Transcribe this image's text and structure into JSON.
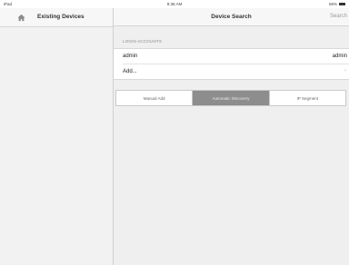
{
  "status_bar": {
    "device": "iPad",
    "time": "9:38 AM",
    "battery": "56%"
  },
  "sidebar": {
    "title": "Existing Devices",
    "home_icon": "home-icon"
  },
  "navbar": {
    "title": "Device Search",
    "search_label": "Search"
  },
  "login_accounts": {
    "section_header": "LOGIN ACCOUNTS",
    "rows": [
      {
        "label": "admin",
        "value": "admin"
      },
      {
        "label": "Add...",
        "value": ""
      }
    ]
  },
  "discovery_tabs": {
    "items": [
      {
        "label": "Manual Add",
        "active": false
      },
      {
        "label": "Automatic Discovery",
        "active": true
      },
      {
        "label": "IP Segment",
        "active": false
      }
    ]
  },
  "colors": {
    "sidebar_bg": "#f2f2f2",
    "content_bg": "#efefef",
    "active_segment": "#8d8d8d"
  }
}
